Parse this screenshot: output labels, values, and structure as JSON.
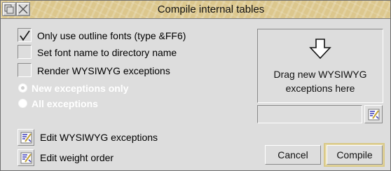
{
  "window": {
    "title": "Compile internal tables",
    "title_bar_color": "#dcc78d"
  },
  "title_bar": {
    "back_icon": "back-icon",
    "close_icon": "close-icon"
  },
  "options": {
    "outline_fonts": {
      "label": "Only use outline fonts (type &FF6)",
      "checked": true
    },
    "set_font_name": {
      "label": "Set font name to directory name",
      "checked": false
    },
    "render_wysiwyg": {
      "label": "Render WYSIWYG exceptions",
      "checked": false
    }
  },
  "radios": {
    "new_only": {
      "label": "New exceptions only",
      "selected": true,
      "enabled": false
    },
    "all": {
      "label": "All exceptions",
      "selected": false,
      "enabled": false
    }
  },
  "drop_zone": {
    "line1": "Drag new WYSIWYG",
    "line2": "exceptions here",
    "icon": "down-arrow-icon"
  },
  "path_field": {
    "value": ""
  },
  "edit_buttons": {
    "wysiwyg": {
      "label": "Edit WYSIWYG exceptions",
      "icon": "edit-icon"
    },
    "weight": {
      "label": "Edit weight order",
      "icon": "edit-icon"
    }
  },
  "actions": {
    "cancel": "Cancel",
    "compile": "Compile"
  },
  "colors": {
    "background": "#dddddd",
    "default_button_ring": "#d9c989",
    "icon_blue": "#3a3ab8"
  }
}
